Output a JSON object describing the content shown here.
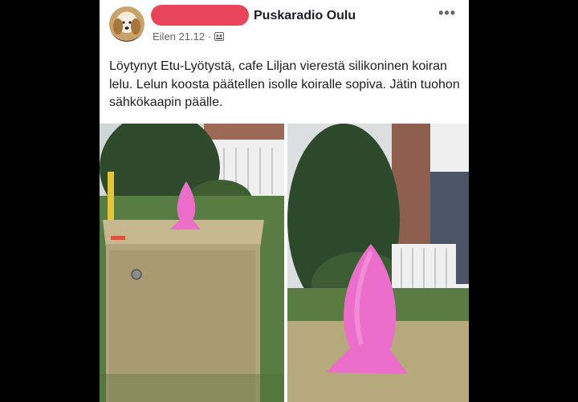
{
  "post": {
    "group_name": "Puskaradio Oulu",
    "timestamp": "Eilen 21.12",
    "separator": "·",
    "audience_icon": "group-icon",
    "more_label": "•••",
    "text": "Löytynyt Etu-Lyötystä, cafe Liljan vierestä silikoninen koiran lelu. Lelun koosta päätellen isolle koiralle sopiva. Jätin tuohon sähkökaapin päälle."
  },
  "colors": {
    "redaction": "#e8455c",
    "toy_pink": "#ec6ecb"
  }
}
